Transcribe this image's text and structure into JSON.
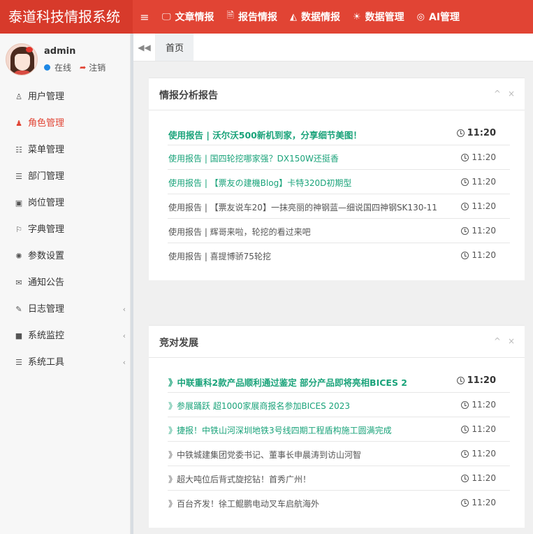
{
  "header": {
    "brand": "泰道科技情报系统",
    "toggle_icon": "≡",
    "nav": [
      {
        "icon": "🖵",
        "label": "文章情报"
      },
      {
        "icon": "🗎",
        "label": "报告情报"
      },
      {
        "icon": "◭",
        "label": "数据情报"
      },
      {
        "icon": "☀",
        "label": "数据管理"
      },
      {
        "icon": "◎",
        "label": "AI管理"
      }
    ]
  },
  "user": {
    "name": "admin",
    "status": "在线",
    "logout": "注销"
  },
  "sidebar": {
    "items": [
      {
        "icon": "♙",
        "label": "用户管理",
        "active": false,
        "expandable": false
      },
      {
        "icon": "♟",
        "label": "角色管理",
        "active": true,
        "expandable": false
      },
      {
        "icon": "☷",
        "label": "菜单管理",
        "active": false,
        "expandable": false
      },
      {
        "icon": "☰",
        "label": "部门管理",
        "active": false,
        "expandable": false
      },
      {
        "icon": "▣",
        "label": "岗位管理",
        "active": false,
        "expandable": false
      },
      {
        "icon": "⚐",
        "label": "字典管理",
        "active": false,
        "expandable": false
      },
      {
        "icon": "✺",
        "label": "参数设置",
        "active": false,
        "expandable": false
      },
      {
        "icon": "✉",
        "label": "通知公告",
        "active": false,
        "expandable": false
      },
      {
        "icon": "✎",
        "label": "日志管理",
        "active": false,
        "expandable": true
      },
      {
        "icon": "■",
        "label": "系统监控",
        "active": false,
        "expandable": true
      },
      {
        "icon": "☰",
        "label": "系统工具",
        "active": false,
        "expandable": true
      }
    ],
    "caret": "‹"
  },
  "tabs": {
    "back_icon": "◀◀",
    "home": "首页"
  },
  "panels": [
    {
      "title": "情报分析报告",
      "collapse_icon": "^",
      "close_icon": "×",
      "items": [
        {
          "title": "使用报告 | 沃尔沃500新机到家，分享细节美图！",
          "time": "11:20",
          "style": "first"
        },
        {
          "title": "使用报告 | 国四轮挖哪家强？DX150W还挺香",
          "time": "11:20",
          "style": "link"
        },
        {
          "title": "使用报告 | 【票友の建機Blog】卡特320D初期型",
          "time": "11:20",
          "style": "link"
        },
        {
          "title": "使用报告 | 【票友说车20】一抹亮丽的神钢蓝—细说国四神钢SK130-11",
          "time": "11:20",
          "style": "plain"
        },
        {
          "title": "使用报告 | 辉哥来啦，轮挖的看过来吧",
          "time": "11:20",
          "style": "plain"
        },
        {
          "title": "使用报告 | 喜提博骄75轮挖",
          "time": "11:20",
          "style": "plain"
        }
      ]
    },
    {
      "title": "竞对发展",
      "collapse_icon": "^",
      "close_icon": "×",
      "items": [
        {
          "title": "》中联重科2款产品顺利通过鉴定 部分产品即将亮相BICES 2",
          "time": "11:20",
          "style": "first"
        },
        {
          "title": "》参展踊跃 超1000家展商报名参加BICES 2023",
          "time": "11:20",
          "style": "link"
        },
        {
          "title": "》捷报！中铁山河深圳地铁3号线四期工程盾构施工圆满完成",
          "time": "11:20",
          "style": "link"
        },
        {
          "title": "》中铁城建集团党委书记、董事长申晨涛到访山河智",
          "time": "11:20",
          "style": "plain"
        },
        {
          "title": "》超大吨位后背式旋挖钻！首秀广州！",
          "time": "11:20",
          "style": "plain"
        },
        {
          "title": "》百台齐发！徐工鲲鹏电动叉车启航海外",
          "time": "11:20",
          "style": "plain"
        }
      ]
    }
  ]
}
